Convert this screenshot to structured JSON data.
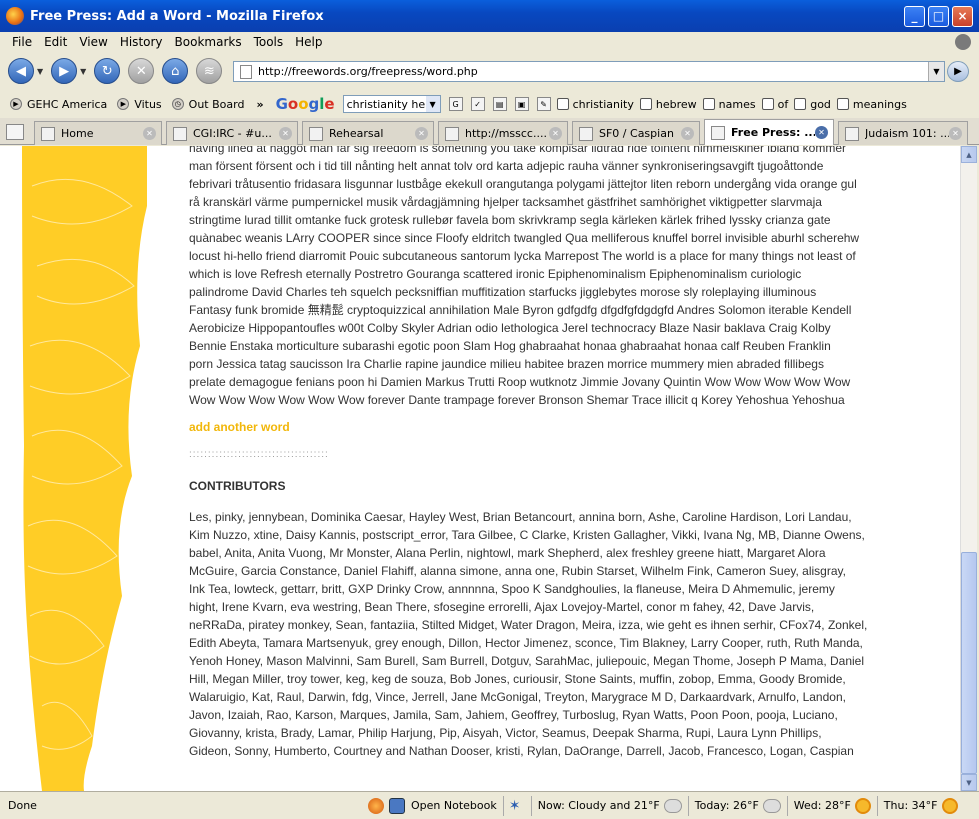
{
  "window": {
    "title": "Free Press: Add a Word - Mozilla Firefox",
    "minimize": "_",
    "maximize": "□",
    "close": "×"
  },
  "menu": [
    "File",
    "Edit",
    "View",
    "History",
    "Bookmarks",
    "Tools",
    "Help"
  ],
  "nav": {
    "back": "◀",
    "forward": "▶",
    "reload": "↻",
    "stop": "✕",
    "home": "⌂",
    "url": "http://freewords.org/freepress/word.php"
  },
  "bookmarks": [
    {
      "label": "GEHC America",
      "icon": "arrow-icon"
    },
    {
      "label": "Vitus",
      "icon": "arrow-icon"
    },
    {
      "label": "Out Board",
      "icon": "clock-icon"
    }
  ],
  "bookmarks_overflow": "»",
  "google": {
    "search_value": "christianity heb",
    "letters": [
      "G",
      "o",
      "o",
      "g",
      "l",
      "e"
    ]
  },
  "highlight_words": [
    "christianity",
    "hebrew",
    "names",
    "of",
    "god",
    "meanings"
  ],
  "tabs": [
    {
      "label": "Home",
      "active": false
    },
    {
      "label": "CGI:IRC - #u...",
      "active": false
    },
    {
      "label": "Rehearsal",
      "active": false
    },
    {
      "label": "http://msscc....",
      "active": false
    },
    {
      "label": "SF0 / Caspian",
      "active": false
    },
    {
      "label": "Free Press: ...",
      "active": true
    },
    {
      "label": "Judaism 101: ...",
      "active": false
    }
  ],
  "page": {
    "word_lines": [
      "having lined at haggot man far sig freedom is something you take kompisar lidtrad ride tointent himmelskiner ibland kommer",
      "man försent försent och i tid till nånting helt annat tolv ord karta adjepic rauha vänner synkroniseringsavgift tjugoåttonde",
      "febrivari tråtusentio fridasara lisgunnar lustbåge ekekull orangutanga polygami jättejtor liten reborn undergång vida orange gul",
      "rå kranskärl värme pumpernickel musik vårdagjämning hjelper tacksamhet gästfrihet samhörighet viktigpetter slarvmaja",
      "stringtime lurad tillit omtanke fuck grotesk rullebør favela bom skrivkramp segla kärleken kärlek frihed lyssky crianza gate",
      "quànabec weanis LArry COOPER since since Floofy eldritch twangled Qua melliferous knuffel borrel invisible aburhl scherehw",
      "locust hi-hello friend diarromit Pouic subcutaneous santorum lycka Marrepost The world is a place for many things not least of",
      "which is love Refresh eternally Postretro Gouranga scattered ironic Epiphenominalism Epiphenominalism curiologic",
      "palindrome David Charles teh squelch pecksniffian muffitization starfucks jigglebytes morose sly roleplaying illuminous",
      "Fantasy funk bromide 無精髭 cryptoquizzical annihilation Male Byron gdfgdfg dfgdfgfdgdgfd Andres Solomon iterable Kendell",
      "Aerobicize Hippopantoufles w00t Colby Skyler Adrian odio lethologica Jerel technocracy Blaze Nasir baklava Craig Kolby",
      "Bennie Enstaka morticulture subarashi egotic poon Slam Hog ghabraahat honaa ghabraahat honaa calf Reuben Franklin",
      "porn Jessica tatag saucisson Ira Charlie rapine jaundice milieu habitee brazen morrice mummery mien abraded fillibegs",
      "prelate demagogue fenians poon hi Damien Markus Trutti Roop wutknotz Jimmie Jovany Quintin Wow Wow Wow Wow Wow",
      "Wow Wow Wow Wow Wow Wow forever Dante trampage forever Bronson Shemar Trace illicit q Korey Yehoshua Yehoshua"
    ],
    "add_link": "add another word",
    "dots": ":::::::::::::::::::::::::::::::::::::",
    "contributors_heading": "CONTRIBUTORS",
    "contributor_lines": [
      "Les, pinky, jennybean, Dominika Caesar, Hayley West, Brian Betancourt, annina born, Ashe, Caroline Hardison, Lori Landau,",
      "Kim Nuzzo, xtine, Daisy Kannis, postscript_error, Tara Gilbee, C Clarke, Kristen Gallagher, Vikki, Ivana Ng, MB, Dianne Owens,",
      "babel, Anita, Anita Vuong, Mr Monster, Alana Perlin, nightowl, mark Shepherd, alex freshley greene hiatt, Margaret Alora",
      "McGuire, Garcia Constance, Daniel Flahiff, alanna simone, anna one, Rubin Starset, Wilhelm Fink, Cameron Suey, alisgray,",
      "Ink Tea, lowteck, gettarr, britt, GXP Drinky Crow, annnnna, Spoo K Sandghoulies, la flaneuse, Meira D Ahmemulic, jeremy",
      "hight, Irene Kvarn, eva westring, Bean There, sfosegine errorelli, Ajax Lovejoy-Martel, conor m fahey, 42, Dave Jarvis,",
      "neRRaDa, piratey monkey, Sean, fantaziia, Stilted Midget, Water Dragon, Meira, izza, wie geht es ihnen serhir, CFox74, Zonkel,",
      "Edith Abeyta, Tamara Martsenyuk, grey enough, Dillon, Hector Jimenez, sconce, Tim Blakney, Larry Cooper, ruth, Ruth Manda,",
      "Yenoh Honey, Mason Malvinni, Sam Burell, Sam Burrell, Dotguv, SarahMac, juliepouic, Megan Thome, Joseph P Mama, Daniel",
      "Hill, Megan Miller, troy tower, keg, keg de souza, Bob Jones, curiousir, Stone Saints, muffin, zobop, Emma, Goody Bromide,",
      "Walaruigio, Kat, Raul, Darwin, fdg, Vince, Jerrell, Jane McGonigal, Treyton, Marygrace M D, Darkaardvark, Arnulfo, Landon,",
      "Javon, Izaiah, Rao, Karson, Marques, Jamila, Sam, Jahiem, Geoffrey, Turboslug, Ryan Watts, Poon Poon, pooja, Luciano,",
      "Giovanny, krista, Brady, Lamar, Philip Harjung, Pip, Aisyah, Victor, Seamus, Deepak Sharma, Rupi, Laura Lynn Phillips,",
      "Gideon, Sonny, Humberto, Courtney and Nathan Dooser, kristi, Rylan, DaOrange, Darrell, Jacob, Francesco, Logan, Caspian"
    ]
  },
  "scroll_position": 0.72,
  "status": {
    "text": "Done",
    "notebook": "Open Notebook",
    "now": "Now: Cloudy and 21°F",
    "today": "Today: 26°F",
    "wed": "Wed: 28°F",
    "thu": "Thu: 34°F"
  },
  "colors": {
    "accent": "#f2b70a",
    "swirl": "#ffc400",
    "titlebar": "#0a4fcc"
  }
}
